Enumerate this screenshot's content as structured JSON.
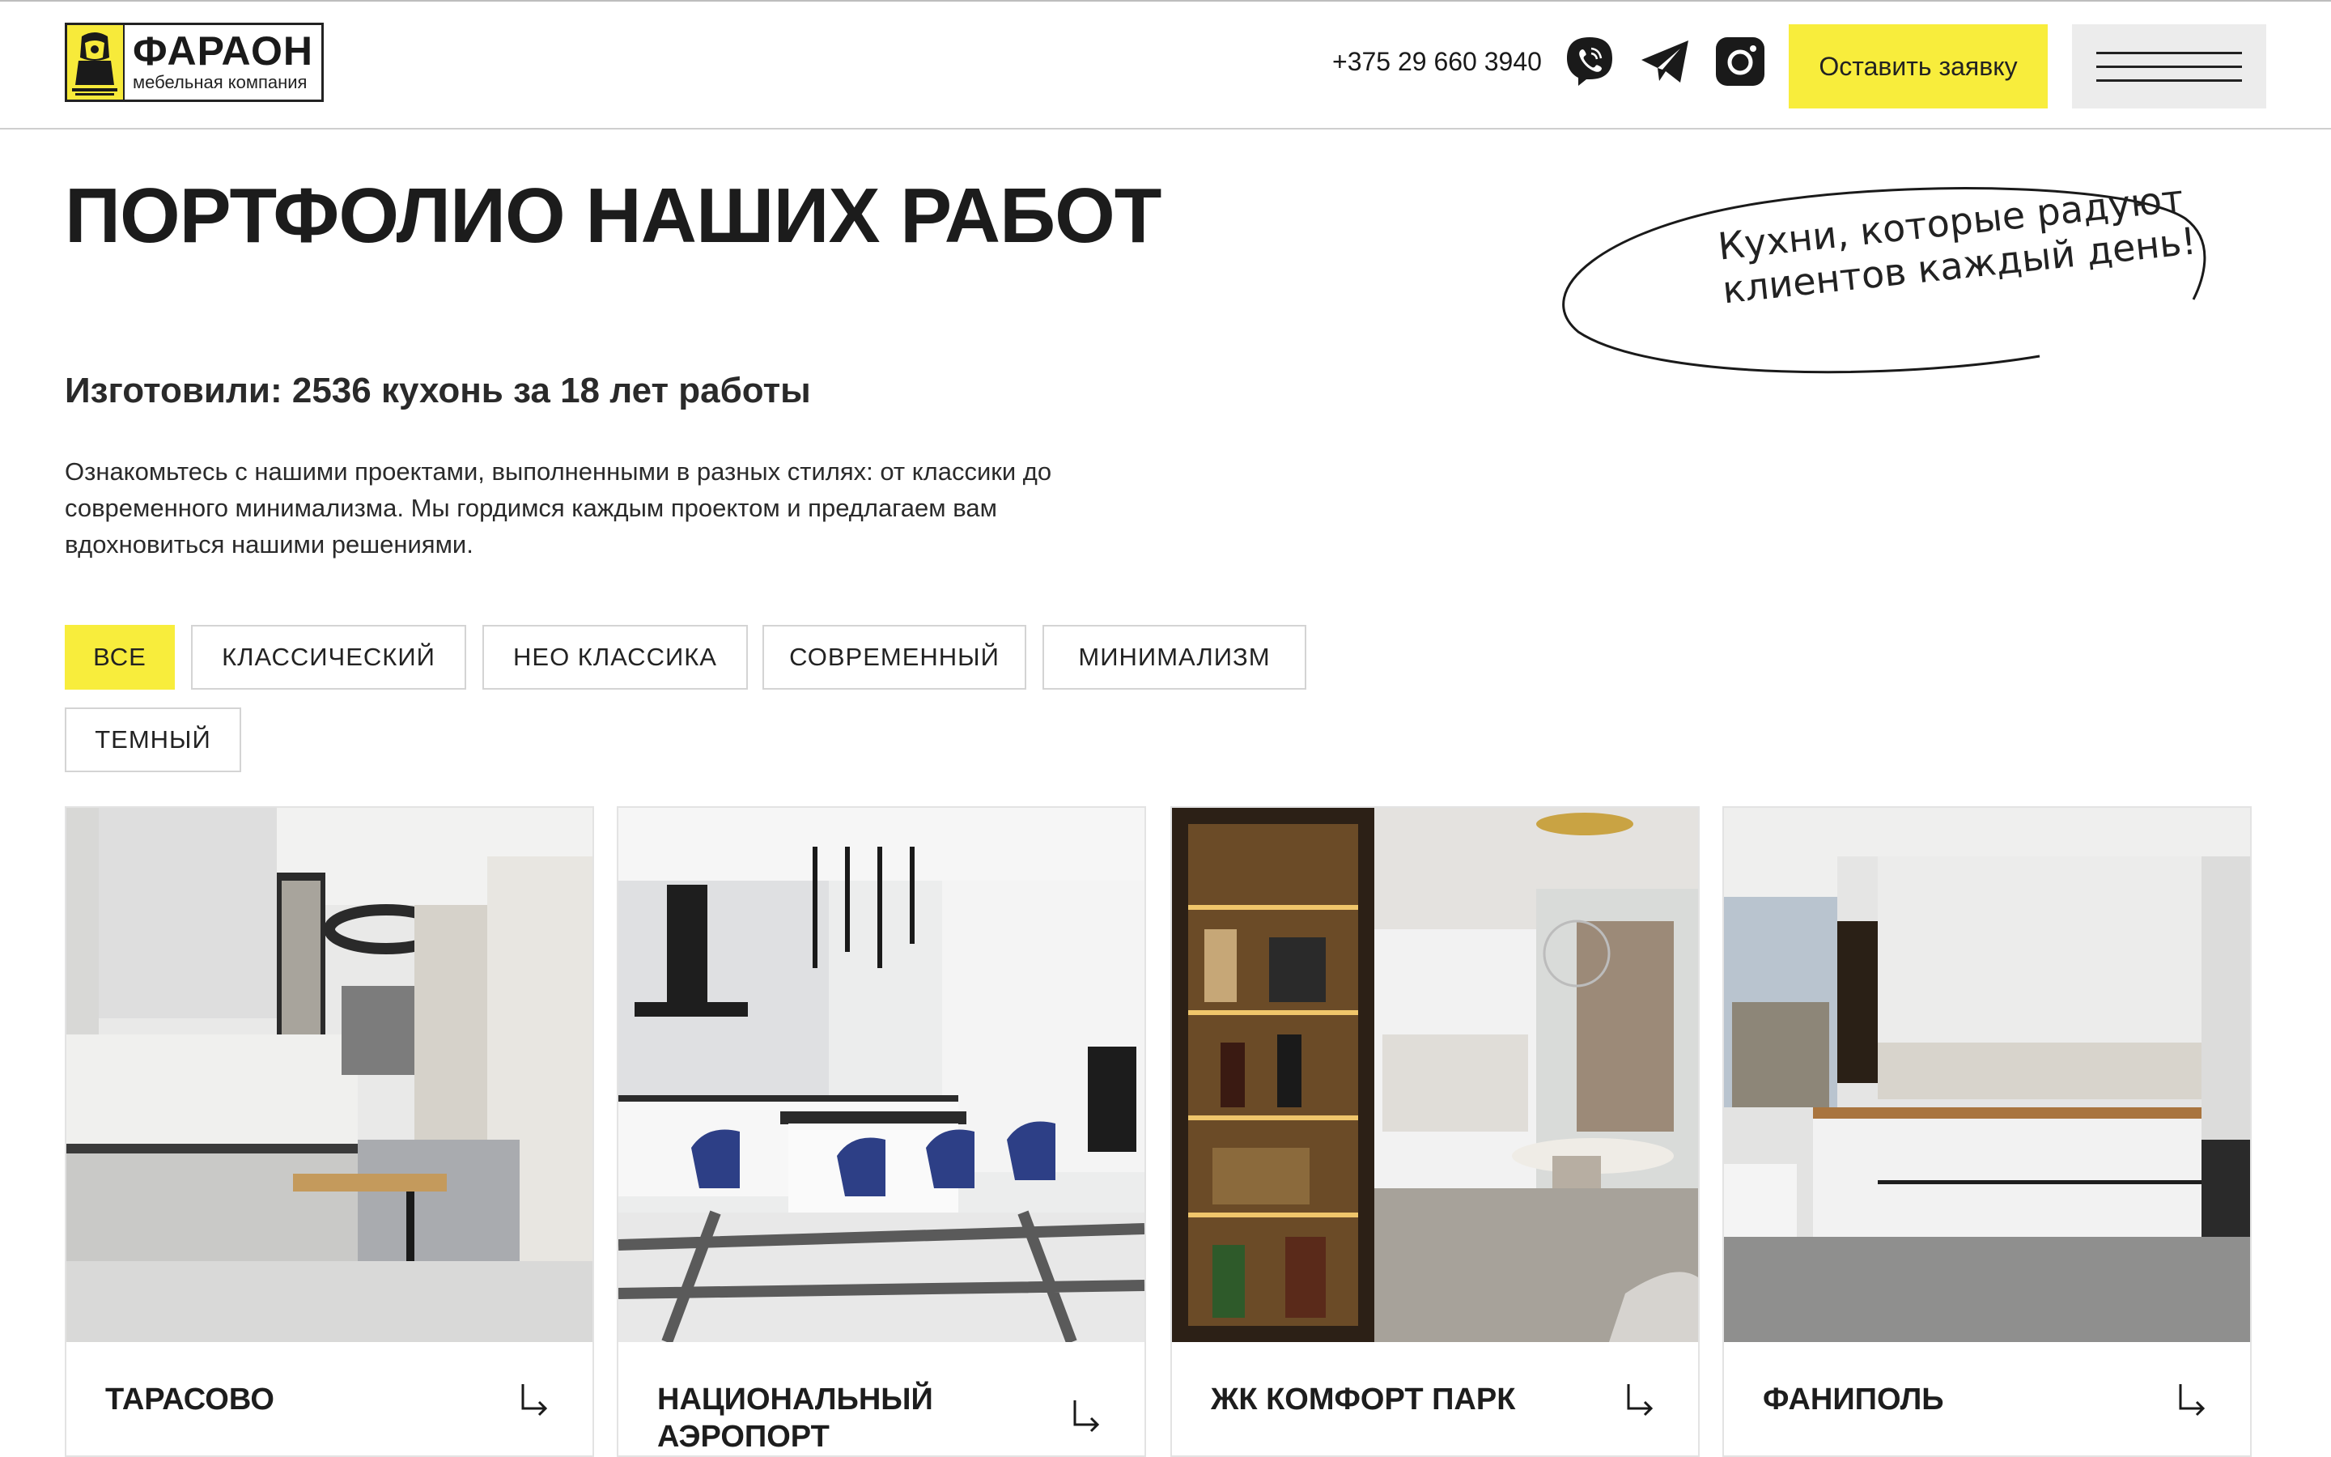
{
  "header": {
    "logo": {
      "name": "ФАРАОН",
      "subtitle": "мебельная компания"
    },
    "phone": "+375 29 660 3940",
    "social": [
      "viber-icon",
      "telegram-icon",
      "instagram-icon"
    ],
    "cta_label": "Оставить заявку",
    "menu_icon": "hamburger-icon"
  },
  "hero": {
    "title": "ПОРТФОЛИО НАШИХ РАБОТ",
    "tagline_line1": "Кухни, которые радуют",
    "tagline_line2": "клиентов каждый день!",
    "subtitle": "Изготовили: 2536 кухонь за 18 лет работы",
    "description": "Ознакомьтесь с нашими проектами, выполненными в разных стилях: от классики до современного минимализма. Мы гордимся каждым проектом и предлагаем вам вдохновиться нашими решениями."
  },
  "filters": {
    "items": [
      "ВСЕ",
      "КЛАССИЧЕСКИЙ",
      "НЕО КЛАССИКА",
      "СОВРЕМЕННЫЙ",
      "МИНИМАЛИЗМ",
      "ТЕМНЫЙ"
    ],
    "active": "ВСЕ"
  },
  "projects": [
    {
      "name": "ТАРАСОВО"
    },
    {
      "name": "НАЦИОНАЛЬНЫЙ АЭРОПОРТ"
    },
    {
      "name": "ЖК КОМФОРТ ПАРК"
    },
    {
      "name": "ФАНИПОЛЬ"
    }
  ],
  "colors": {
    "accent": "#f8ed3c",
    "text": "#1d1d1d",
    "border": "#d4d4d4"
  }
}
